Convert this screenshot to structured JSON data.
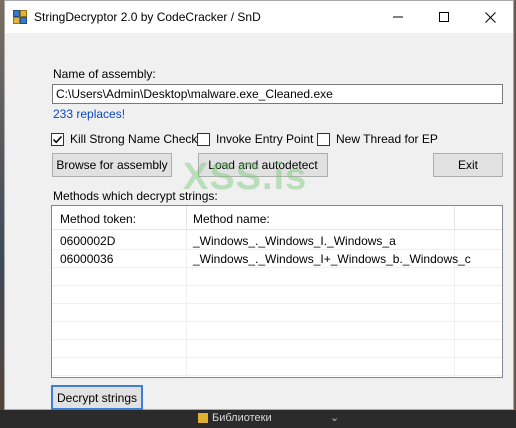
{
  "window": {
    "title": "StringDecryptor 2.0 by CodeCracker / SnD",
    "minimize_icon": "minimize-icon",
    "maximize_icon": "maximize-icon",
    "close_icon": "close-icon"
  },
  "assembly": {
    "label": "Name of assembly:",
    "path": "C:\\Users\\Admin\\Desktop\\malware.exe_Cleaned.exe",
    "replaces": "233 replaces!",
    "replaces_color": "#0b47c0"
  },
  "options": {
    "kill_strong_name": {
      "label": "Kill Strong Name Check",
      "checked": true
    },
    "invoke_entry_point": {
      "label": "Invoke Entry Point",
      "checked": false
    },
    "new_thread": {
      "label": "New Thread for EP",
      "checked": false
    }
  },
  "buttons": {
    "browse": "Browse for assembly",
    "load": "Load and autodetect",
    "exit": "Exit",
    "decrypt": "Decrypt strings"
  },
  "watermark": "XSS.is",
  "methods": {
    "label": "Methods which decrypt strings:",
    "columns": [
      "Method token:",
      "Method name:"
    ],
    "rows": [
      {
        "token": "0600002D",
        "name": "_Windows_._Windows_I._Windows_a"
      },
      {
        "token": "06000036",
        "name": "_Windows_._Windows_I+_Windows_b._Windows_c"
      }
    ]
  },
  "taskbar": {
    "text": "Библиотеки"
  }
}
